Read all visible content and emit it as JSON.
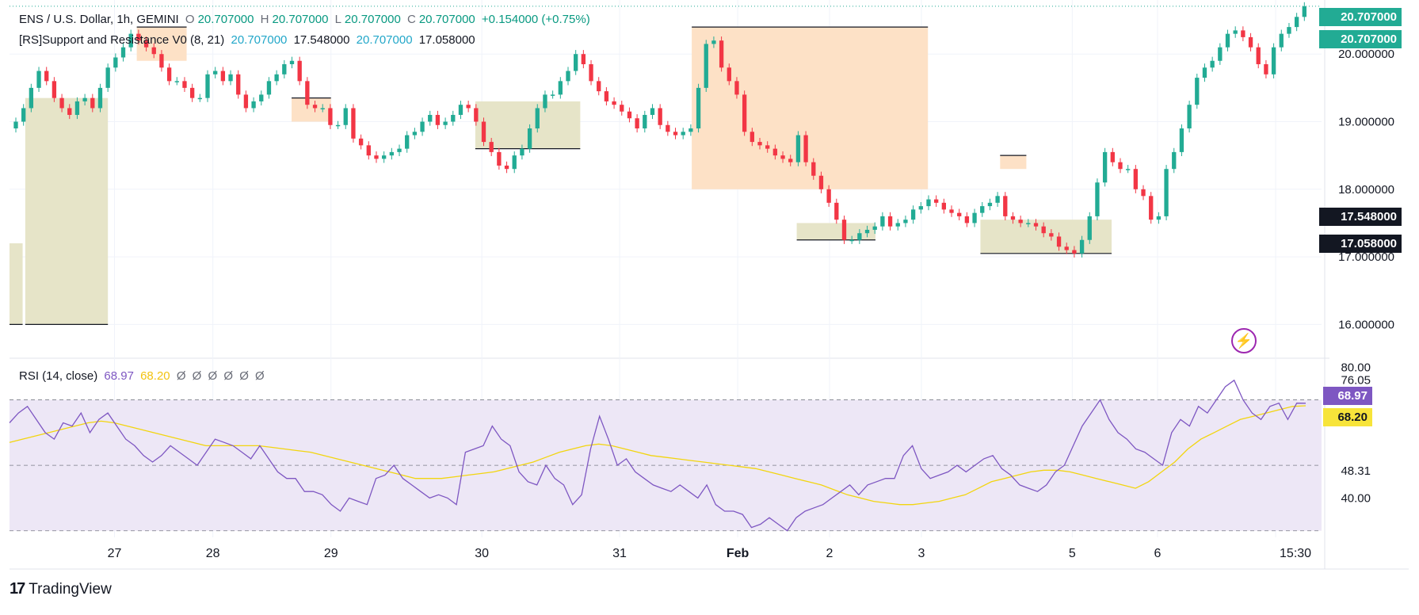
{
  "header": {
    "symbol": "ENS / U.S. Dollar, 1h, GEMINI",
    "o_label": "O",
    "o_value": "20.707000",
    "h_label": "H",
    "h_value": "20.707000",
    "l_label": "L",
    "l_value": "20.707000",
    "c_label": "C",
    "c_value": "20.707000",
    "change": "+0.154000 (+0.75%)"
  },
  "indicator": {
    "name": "[RS]Support and Resistance V0 (8, 21)",
    "v1": "20.707000",
    "v2": "17.548000",
    "v3": "20.707000",
    "v4": "17.058000"
  },
  "rsi_legend": {
    "name": "RSI (14, close)",
    "v1": "68.97",
    "v2": "68.20",
    "zeros": [
      "Ø",
      "Ø",
      "Ø",
      "Ø",
      "Ø",
      "Ø"
    ]
  },
  "price_tags": [
    {
      "text": "20.707000",
      "bg": "#22ab94",
      "fg": "#ffffff"
    },
    {
      "text": "20.707000",
      "bg": "#22ab94",
      "fg": "#ffffff"
    },
    {
      "text": "17.548000",
      "bg": "#131722",
      "fg": "#ffffff"
    },
    {
      "text": "17.058000",
      "bg": "#131722",
      "fg": "#ffffff"
    }
  ],
  "rsi_tags": [
    {
      "text": "68.97",
      "bg": "#7e57c2",
      "fg": "#ffffff"
    },
    {
      "text": "68.20",
      "bg": "#f7e43a",
      "fg": "#131722"
    }
  ],
  "branding": "TradingView",
  "colors": {
    "up": "#22ab94",
    "down": "#f23645",
    "resistance_fill": "#fde1c6",
    "support_fill": "#e6e4c8",
    "rsi": "#7e57c2",
    "rsi_ma": "#f2d50f",
    "rsi_band": "#ede7f6"
  },
  "icons": {
    "lightning": "lightning-icon"
  },
  "chart_data": [
    {
      "type": "candlestick",
      "series_name": "ENS / U.S. Dollar",
      "timeframe": "1h",
      "exchange": "GEMINI",
      "x_ticks": [
        "27",
        "28",
        "29",
        "30",
        "31",
        "Feb",
        "2",
        "3",
        "5",
        "6",
        "15:30"
      ],
      "y_ticks": [
        16,
        17,
        18,
        19,
        20
      ],
      "y_tick_labels": [
        "16.000000",
        "17.000000",
        "18.000000",
        "19.000000",
        "20.000000"
      ],
      "ylim": [
        15.5,
        20.8
      ],
      "closes": [
        19,
        19.2,
        19.5,
        19.75,
        19.6,
        19.35,
        19.2,
        19.1,
        19.3,
        19.35,
        19.2,
        19.5,
        19.8,
        19.95,
        20.1,
        20.3,
        20.2,
        20.1,
        20,
        19.8,
        19.6,
        19.6,
        19.5,
        19.35,
        19.35,
        19.7,
        19.75,
        19.6,
        19.7,
        19.4,
        19.2,
        19.3,
        19.4,
        19.6,
        19.7,
        19.85,
        19.9,
        19.6,
        19.25,
        19.2,
        19.2,
        18.95,
        18.95,
        19.2,
        18.75,
        18.65,
        18.5,
        18.45,
        18.5,
        18.55,
        18.6,
        18.8,
        18.85,
        19,
        19.1,
        18.95,
        19,
        19.1,
        19.25,
        19.2,
        19,
        18.7,
        18.55,
        18.35,
        18.3,
        18.5,
        18.6,
        18.9,
        19.2,
        19.4,
        19.4,
        19.6,
        19.75,
        20,
        19.85,
        19.6,
        19.45,
        19.3,
        19.25,
        19.15,
        19.05,
        18.9,
        19.1,
        19.2,
        18.95,
        18.85,
        18.8,
        18.85,
        18.9,
        19.5,
        20.15,
        20.2,
        19.8,
        19.6,
        19.4,
        18.85,
        18.7,
        18.65,
        18.6,
        18.5,
        18.45,
        18.4,
        18.8,
        18.4,
        18.2,
        18,
        17.8,
        17.55,
        17.25,
        17.25,
        17.35,
        17.4,
        17.45,
        17.6,
        17.45,
        17.5,
        17.55,
        17.7,
        17.75,
        17.85,
        17.8,
        17.7,
        17.65,
        17.6,
        17.5,
        17.65,
        17.75,
        17.8,
        17.9,
        17.6,
        17.55,
        17.5,
        17.5,
        17.45,
        17.35,
        17.3,
        17.15,
        17.1,
        17.05,
        17.25,
        17.6,
        18.1,
        18.55,
        18.4,
        18.3,
        18.3,
        18.0,
        17.9,
        17.55,
        17.6,
        18.3,
        18.55,
        18.9,
        19.25,
        19.65,
        19.8,
        19.9,
        20.1,
        20.3,
        20.35,
        20.25,
        20.1,
        19.85,
        19.7,
        20.1,
        20.3,
        20.4,
        20.55,
        20.707
      ]
    },
    {
      "type": "line",
      "title": "RSI (14, close)",
      "y_ticks": [
        40.0,
        48.31,
        68.2,
        68.97,
        76.05,
        80.0
      ],
      "y_tick_labels": [
        "40.00",
        "48.31",
        "68.20",
        "68.97",
        "76.05",
        "80.00"
      ],
      "ylim": [
        28,
        82
      ],
      "bands": [
        30,
        50,
        70
      ],
      "series": [
        {
          "name": "RSI",
          "values": [
            63,
            66,
            68,
            64,
            60,
            58,
            63,
            62,
            66,
            60,
            64,
            66,
            62,
            58,
            56,
            53,
            51,
            53,
            56,
            54,
            52,
            50,
            54,
            58,
            57,
            56,
            54,
            52,
            56,
            52,
            48,
            46,
            46,
            42,
            42,
            41,
            38,
            36,
            40,
            39,
            38,
            46,
            47,
            50,
            46,
            44,
            42,
            40,
            41,
            40,
            38,
            54,
            55,
            56,
            62,
            58,
            56,
            48,
            45,
            44,
            50,
            46,
            44,
            38,
            41,
            55,
            65,
            58,
            50,
            52,
            48,
            46,
            44,
            43,
            42,
            44,
            42,
            40,
            44,
            38,
            36,
            36,
            35,
            31,
            32,
            34,
            32,
            30,
            34,
            36,
            37,
            38,
            40,
            42,
            44,
            41,
            44,
            45,
            46,
            46,
            53,
            56,
            49,
            46,
            47,
            48,
            50,
            48,
            50,
            52,
            53,
            49,
            47,
            44,
            43,
            42,
            44,
            48,
            50,
            56,
            62,
            66,
            70,
            64,
            60,
            58,
            55,
            54,
            52,
            50,
            60,
            64,
            62,
            68,
            66,
            70,
            74,
            76,
            70,
            66,
            64,
            68,
            69,
            64,
            69,
            68.97
          ]
        },
        {
          "name": "MA",
          "values": [
            57,
            58,
            59,
            60,
            61,
            62,
            63,
            63.5,
            63,
            62,
            61,
            60,
            59,
            58,
            57,
            56,
            56,
            56,
            56,
            56,
            55.5,
            55,
            54.5,
            54,
            53,
            52,
            51,
            50,
            49,
            48,
            47,
            46,
            46,
            46,
            46.5,
            47,
            47.5,
            48,
            49,
            50,
            51,
            52.5,
            54,
            55,
            56,
            56.5,
            56,
            55,
            54,
            53,
            52.5,
            52,
            51.5,
            51,
            50.5,
            50,
            49.5,
            49,
            48,
            47,
            46,
            45,
            44,
            42.5,
            41,
            40,
            39,
            38.5,
            38,
            38,
            38.5,
            39,
            40,
            41,
            43,
            45,
            46,
            47,
            48,
            48.5,
            48.5,
            48,
            47,
            46,
            45,
            44,
            43,
            45,
            48,
            51,
            55,
            58,
            60,
            62,
            64,
            65,
            66,
            67,
            68,
            68.2
          ]
        }
      ]
    }
  ]
}
